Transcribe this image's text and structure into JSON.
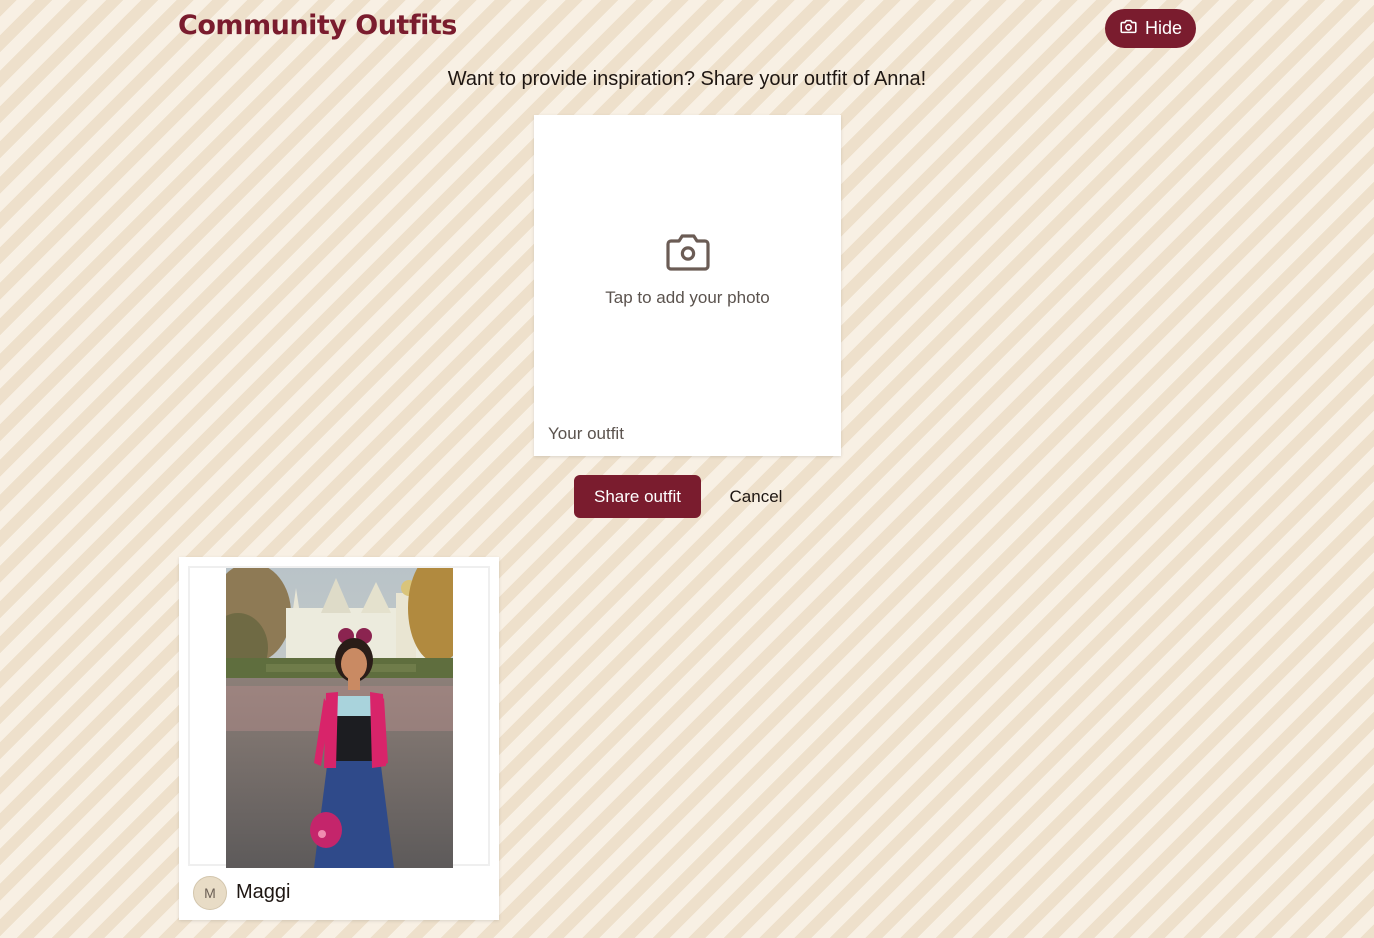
{
  "header": {
    "title": "Community Outfits",
    "hide_label": "Hide",
    "hide_icon": "camera-icon"
  },
  "share": {
    "prompt": "Want to provide inspiration? Share your outfit of Anna!",
    "upload_icon": "camera-icon",
    "upload_hint": "Tap to add your photo",
    "caption_placeholder": "Your outfit",
    "share_label": "Share outfit",
    "cancel_label": "Cancel"
  },
  "outfits": [
    {
      "user_initial": "M",
      "user_name": "Maggi"
    }
  ],
  "colors": {
    "accent": "#7a1c2e",
    "background": "#f5ebdc",
    "stripe": "#eee0cb",
    "text": "#1e1612",
    "muted_text": "#5b534e"
  }
}
